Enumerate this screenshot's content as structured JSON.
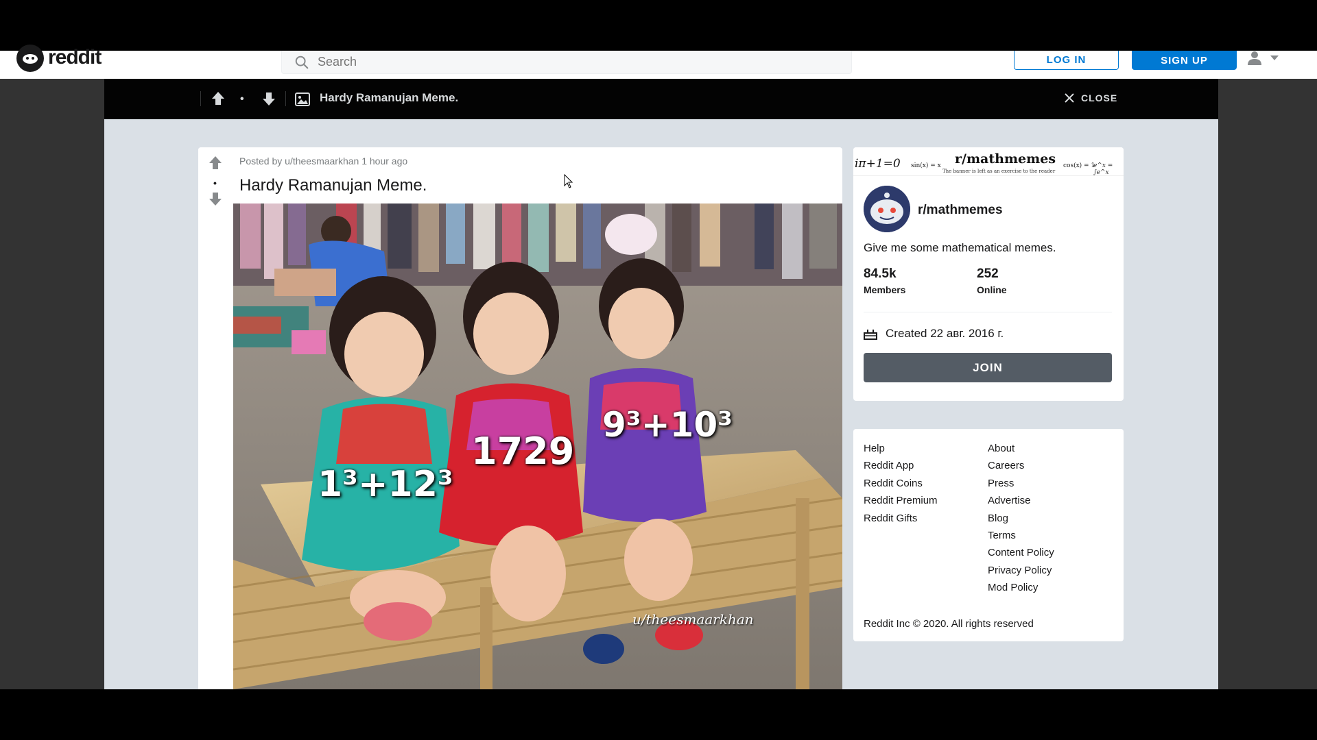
{
  "header": {
    "logo_text": "reddit",
    "search_placeholder": "Search",
    "login_label": "LOG IN",
    "signup_label": "SIGN UP"
  },
  "post_bar": {
    "title": "Hardy Ramanujan Meme.",
    "vote_score": "•",
    "close_label": "CLOSE"
  },
  "post": {
    "meta": "Posted by u/theesmaarkhan 1 hour ago",
    "title": "Hardy Ramanujan Meme.",
    "vote_score": "•",
    "image_labels": {
      "left": "1³+12³",
      "center": "1729",
      "right": "9³+10³",
      "watermark": "u/theesmaarkhan"
    }
  },
  "community": {
    "banner_title": "r/mathmemes",
    "banner_note": "The banner is left as an exercise to the reader",
    "banner_euler": "iπ+1=0",
    "banner_sin": "sin(x) = x",
    "banner_cos": "cos(x) = 1",
    "banner_int": "e^x = ∫e^x",
    "name": "r/mathmemes",
    "description": "Give me some mathematical memes.",
    "members_count": "84.5k",
    "members_label": "Members",
    "online_count": "252",
    "online_label": "Online",
    "created": "Created 22 авг. 2016 г.",
    "join_label": "JOIN"
  },
  "footer": {
    "left_links": [
      "Help",
      "Reddit App",
      "Reddit Coins",
      "Reddit Premium",
      "Reddit Gifts"
    ],
    "right_links": [
      "About",
      "Careers",
      "Press",
      "Advertise",
      "Blog",
      "Terms",
      "Content Policy",
      "Privacy Policy",
      "Mod Policy"
    ],
    "copyright": "Reddit Inc © 2020. All rights reserved"
  },
  "colors": {
    "accent": "#0079d3",
    "join_button": "#545c65",
    "overlay_bg": "#dae0e6",
    "post_bar_bg": "#030303"
  }
}
